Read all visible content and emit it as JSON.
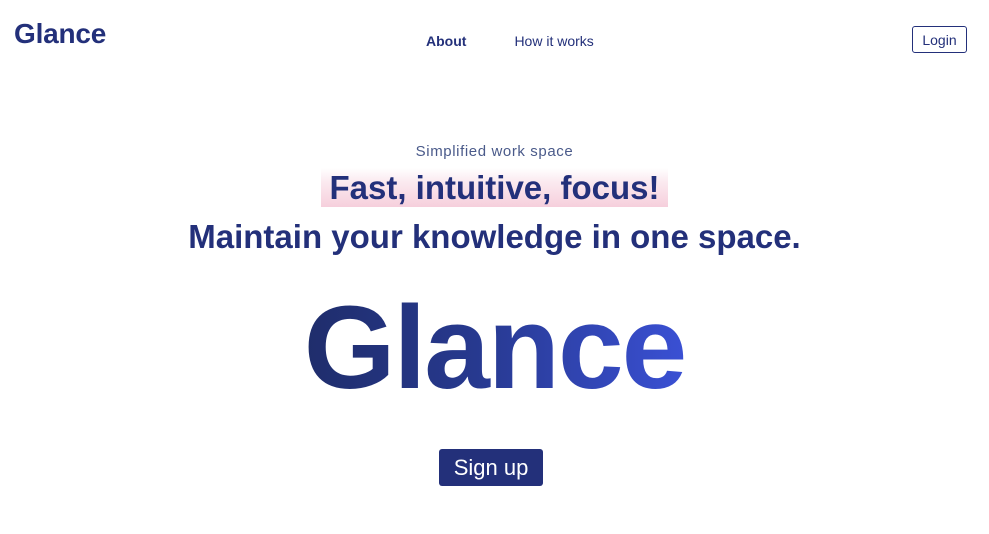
{
  "header": {
    "logo": "Glance",
    "nav": [
      {
        "label": "About",
        "active": true
      },
      {
        "label": "How it works",
        "active": false
      }
    ],
    "login_label": "Login"
  },
  "hero": {
    "eyebrow": "Simplified work space",
    "tagline": "Fast, intuitive, focus!",
    "headline": "Maintain your knowledge in one space.",
    "brand": "Glance",
    "signup_label": "Sign up"
  },
  "colors": {
    "primary": "#23307a",
    "gradient_end": "#3a50d4",
    "highlight": "#f6cfdc"
  }
}
